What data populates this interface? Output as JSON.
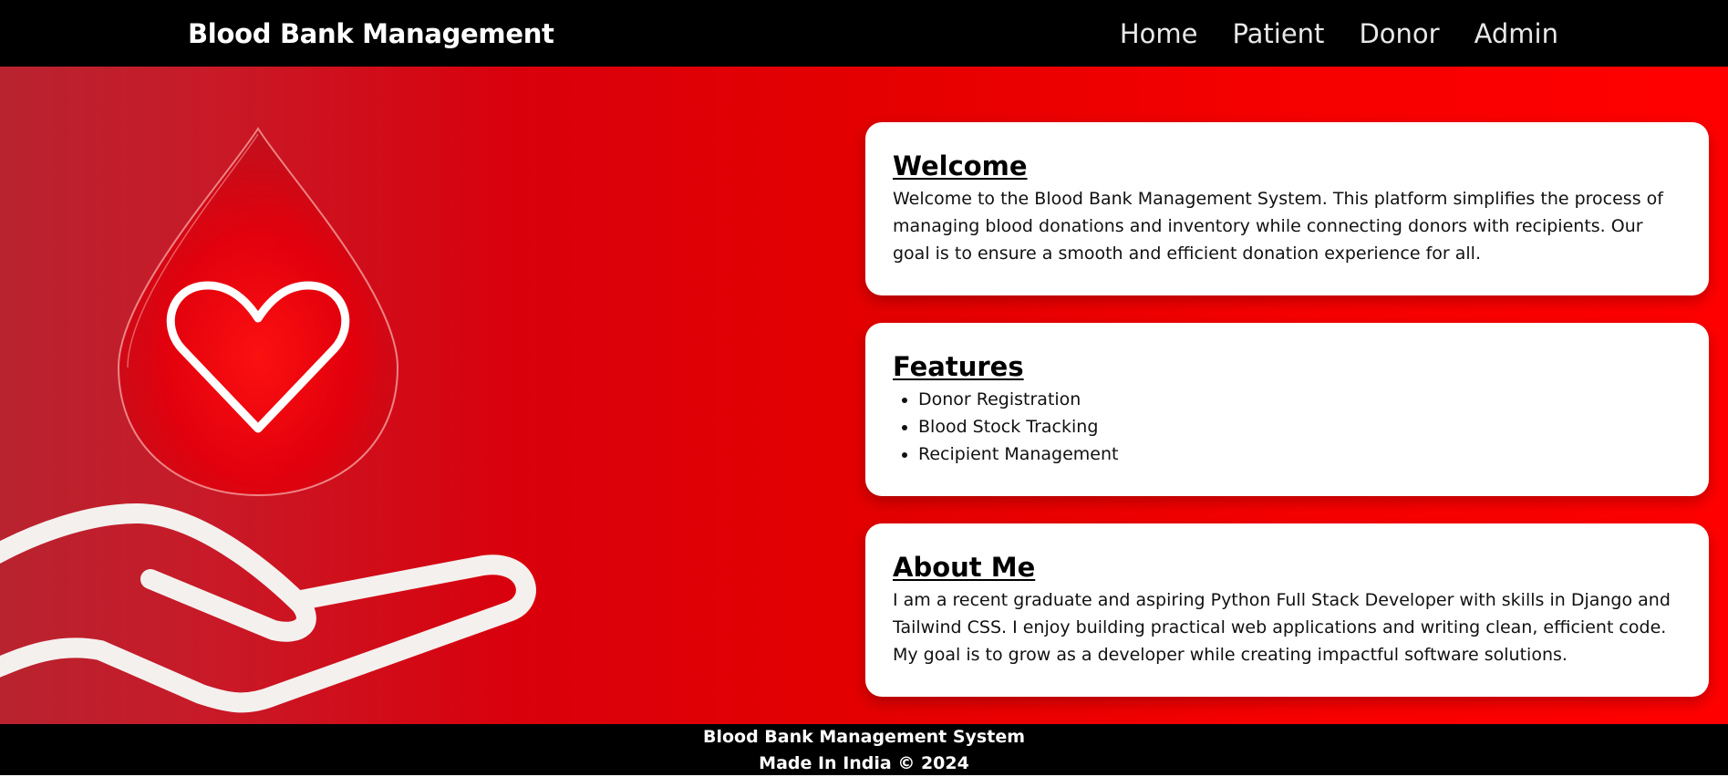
{
  "navbar": {
    "brand": "Blood Bank Management",
    "links": [
      {
        "label": "Home"
      },
      {
        "label": "Patient"
      },
      {
        "label": "Donor"
      },
      {
        "label": "Admin"
      }
    ]
  },
  "hero": {
    "art_icons": [
      "blood-drop-icon",
      "heart-icon",
      "hand-icon"
    ]
  },
  "cards": {
    "welcome": {
      "title": "Welcome",
      "text": "Welcome to the Blood Bank Management System. This platform simplifies the process of managing blood donations and inventory while connecting donors with recipients. Our goal is to ensure a smooth and efficient donation experience for all."
    },
    "features": {
      "title": "Features",
      "items": [
        "Donor Registration",
        "Blood Stock Tracking",
        "Recipient Management"
      ]
    },
    "about": {
      "title": "About Me",
      "text": "I am a recent graduate and aspiring Python Full Stack Developer with skills in Django and Tailwind CSS. I enjoy building practical web applications and writing clean, efficient code. My goal is to grow as a developer while creating impactful software solutions."
    }
  },
  "footer": {
    "line1": "Blood Bank Management System",
    "line2": "Made In India © 2024"
  },
  "colors": {
    "navbar_bg": "#000000",
    "hero_red": "#ff0000",
    "card_bg": "#ffffff",
    "footer_bg": "#000000"
  }
}
